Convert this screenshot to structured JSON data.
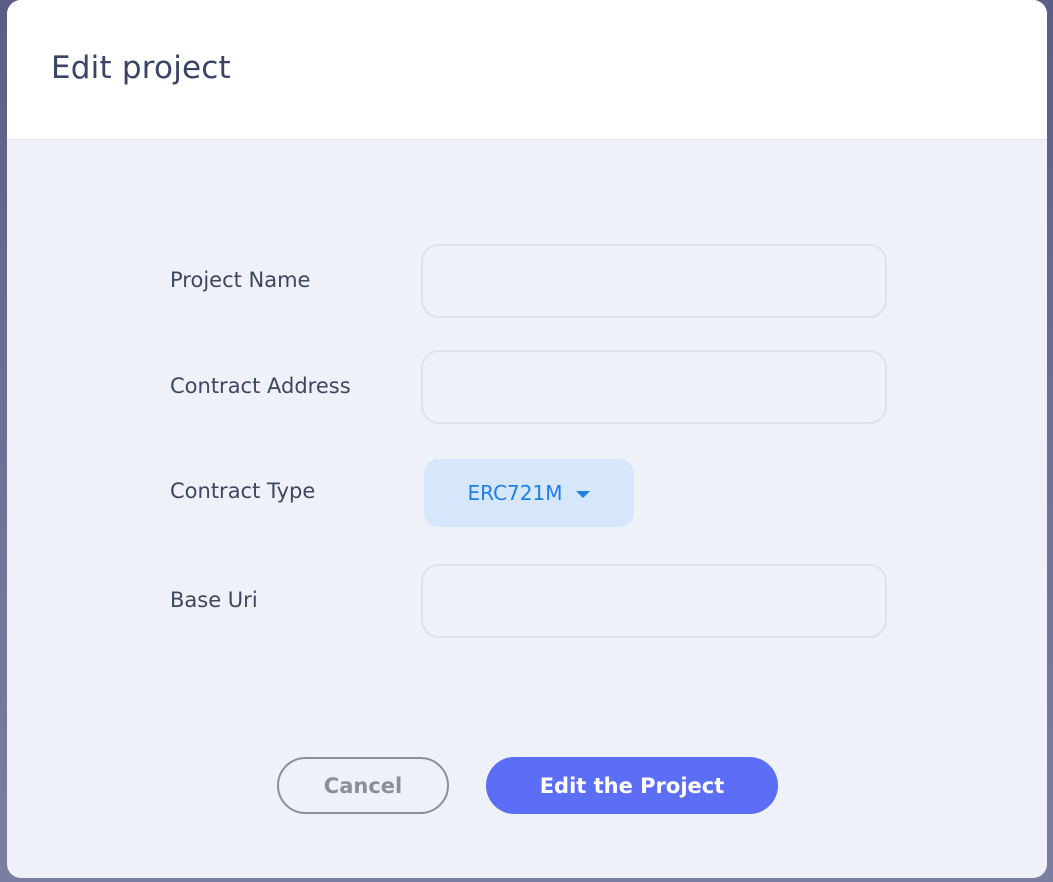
{
  "modal": {
    "title": "Edit project"
  },
  "form": {
    "project_name": {
      "label": "Project Name",
      "value": "",
      "placeholder": ""
    },
    "contract_address": {
      "label": "Contract Address",
      "value": "",
      "placeholder": ""
    },
    "contract_type": {
      "label": "Contract Type",
      "selected": "ERC721M",
      "icon": "caret-down-icon"
    },
    "base_uri": {
      "label": "Base Uri",
      "value": "",
      "placeholder": ""
    }
  },
  "actions": {
    "cancel_label": "Cancel",
    "submit_label": "Edit the Project"
  },
  "colors": {
    "accent": "#5b6ef5",
    "select_text": "#1e7fe6",
    "select_bg": "#d6e7fb",
    "title": "#3a4466"
  }
}
